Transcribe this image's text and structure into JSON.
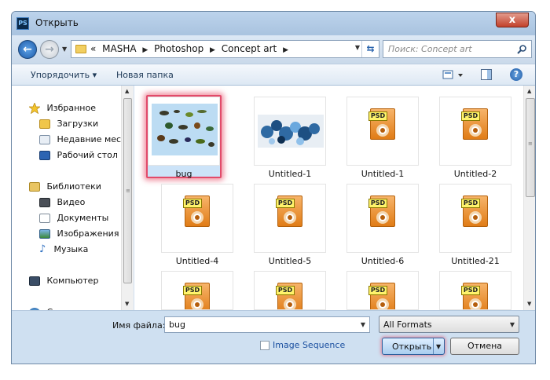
{
  "window": {
    "title": "Открыть",
    "app_icon": "PS",
    "close_glyph": "x"
  },
  "navbar": {
    "breadcrumb": [
      "«",
      "MASHA",
      "Photoshop",
      "Concept art"
    ],
    "search_placeholder": "Поиск: Concept art"
  },
  "toolbar": {
    "organize_label": "Упорядочить ▾",
    "new_folder_label": "Новая папка",
    "help_glyph": "?"
  },
  "sidebar": {
    "items": [
      {
        "label": "Избранное",
        "icon": "star-icon"
      },
      {
        "label": "Загрузки",
        "icon": "downloads-icon"
      },
      {
        "label": "Недавние места",
        "icon": "recent-places-icon"
      },
      {
        "label": "Рабочий стол",
        "icon": "desktop-icon"
      },
      {
        "label": "Библиотеки",
        "icon": "libraries-icon"
      },
      {
        "label": "Видео",
        "icon": "video-icon"
      },
      {
        "label": "Документы",
        "icon": "documents-icon"
      },
      {
        "label": "Изображения",
        "icon": "images-icon"
      },
      {
        "label": "Музыка",
        "icon": "music-icon"
      },
      {
        "label": "Компьютер",
        "icon": "computer-icon"
      },
      {
        "label": "Сеть",
        "icon": "network-icon"
      }
    ]
  },
  "files": [
    {
      "name": "bug",
      "kind": "image-bugs",
      "selected": true
    },
    {
      "name": "Untitled-1",
      "kind": "image-splash"
    },
    {
      "name": "Untitled-1",
      "kind": "psd"
    },
    {
      "name": "Untitled-2",
      "kind": "psd"
    },
    {
      "name": "Untitled-4",
      "kind": "psd"
    },
    {
      "name": "Untitled-5",
      "kind": "psd"
    },
    {
      "name": "Untitled-6",
      "kind": "psd"
    },
    {
      "name": "Untitled-21",
      "kind": "psd"
    },
    {
      "name": "",
      "kind": "psd"
    },
    {
      "name": "",
      "kind": "psd"
    },
    {
      "name": "",
      "kind": "psd"
    },
    {
      "name": "",
      "kind": "psd"
    }
  ],
  "psd_tag": "PSD",
  "bottom": {
    "filename_label": "Имя файла:",
    "filename_value": "bug",
    "filter_value": "All Formats",
    "image_sequence_label": "Image Sequence",
    "open_label": "Открыть",
    "cancel_label": "Отмена"
  }
}
